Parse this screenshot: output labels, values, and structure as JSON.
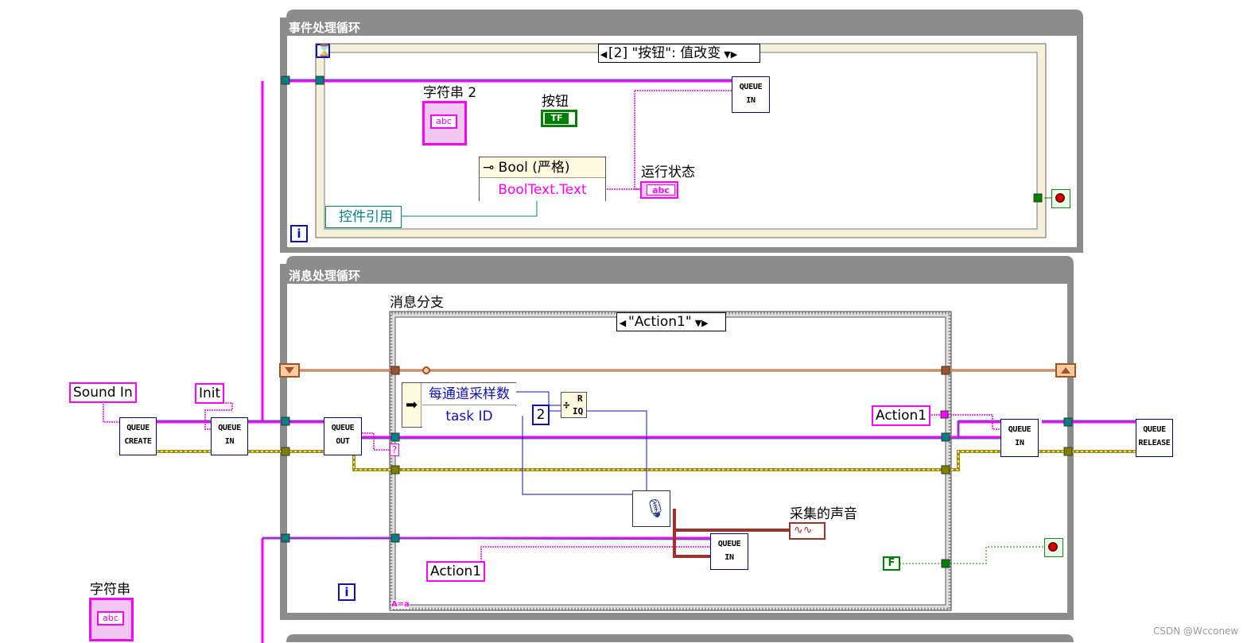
{
  "event_loop": {
    "title": "事件处理循环",
    "event_selector": "[2] \"按钮\": 值改变",
    "queue_in": [
      "QUEUE",
      "IN"
    ],
    "string2_label": "字符串 2",
    "string2_icon": "abc",
    "button_label": "按钮",
    "button_icon": "TF",
    "property_node": {
      "header": "Bool (严格)",
      "item": "BoolText.Text"
    },
    "run_state_label": "运行状态",
    "run_state_icon": "abc",
    "control_ref": "控件引用",
    "iteration": "i"
  },
  "message_loop": {
    "title": "消息处理循环",
    "case_label": "消息分支",
    "case_selector": "\"Action1\"",
    "unbundle": {
      "item1": "每通道采样数",
      "item2": "task ID"
    },
    "constant_2": "2",
    "quotient_top": "R",
    "quotient_bottom": "IQ",
    "action1_right": "Action1",
    "action1_bottom": "Action1",
    "acquired_sound_label": "采集的声音",
    "false_constant": "F",
    "iteration": "i",
    "question_mark": "?",
    "case_tunnel": "A=a"
  },
  "outside": {
    "sound_in": "Sound In",
    "init": "Init",
    "queue_create": [
      "QUEUE",
      "CREATE"
    ],
    "queue_in_left": [
      "QUEUE",
      "IN"
    ],
    "queue_out": [
      "QUEUE",
      "OUT"
    ],
    "queue_in_right": [
      "QUEUE",
      "IN"
    ],
    "queue_release": [
      "QUEUE",
      "RELEASE"
    ],
    "string_label": "字符串",
    "string_icon": "abc"
  },
  "watermark": "CSDN @Wcconew",
  "colors": {
    "loop_frame": "#8c8c8c",
    "string_wire": "#ff00ff",
    "error_wire": "#9c8b1a",
    "refnum_wire": "#008080",
    "int_wire": "#1010c0",
    "bool_wire": "#008000",
    "shift_register": "#a0522d"
  }
}
